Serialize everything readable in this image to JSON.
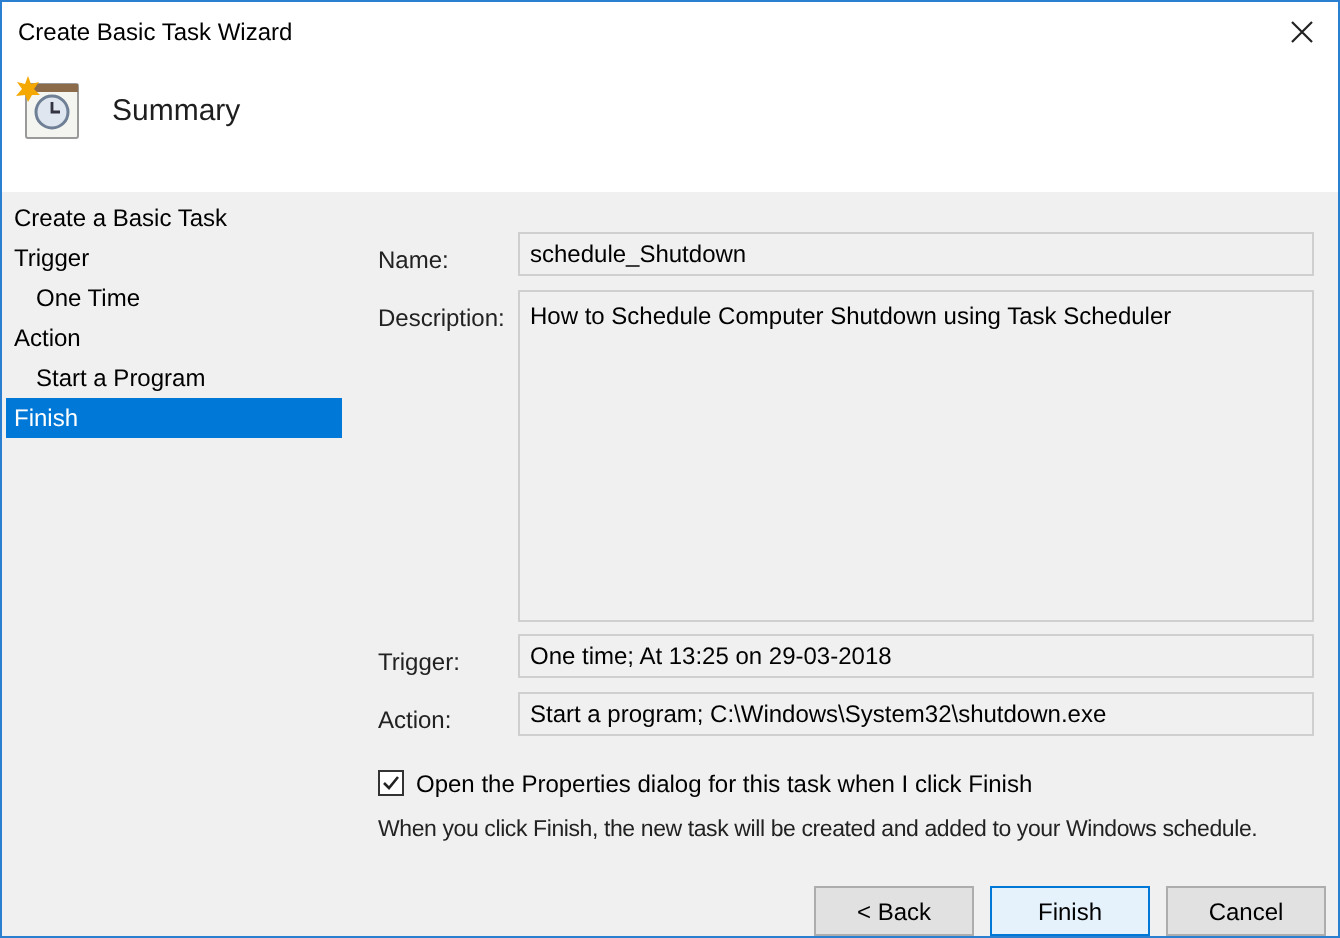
{
  "window": {
    "title": "Create Basic Task Wizard",
    "heading": "Summary"
  },
  "steps": [
    {
      "label": "Create a Basic Task",
      "selected": false
    },
    {
      "label": "Trigger",
      "selected": false,
      "children": [
        {
          "label": "One Time",
          "selected": false
        }
      ]
    },
    {
      "label": "Action",
      "selected": false,
      "children": [
        {
          "label": "Start a Program",
          "selected": false
        }
      ]
    },
    {
      "label": "Finish",
      "selected": true
    }
  ],
  "fields": [
    {
      "kind": "line",
      "label": "Name:",
      "value": "schedule_Shutdown"
    },
    {
      "kind": "area",
      "label": "Description:",
      "value": "How to Schedule Computer Shutdown using Task Scheduler"
    },
    {
      "kind": "line",
      "label": "Trigger:",
      "value": "One time; At 13:25 on 29-03-2018"
    },
    {
      "kind": "line",
      "label": "Action:",
      "value": "Start a program; C:\\Windows\\System32\\shutdown.exe"
    }
  ],
  "open_properties": {
    "label": "Open the Properties dialog for this task when I click Finish",
    "checked": true
  },
  "note": "When you click Finish, the new task will be created and added to your Windows schedule.",
  "buttons": [
    {
      "label": "< Back",
      "default": false
    },
    {
      "label": "Finish",
      "default": true
    },
    {
      "label": "Cancel",
      "default": false
    }
  ]
}
